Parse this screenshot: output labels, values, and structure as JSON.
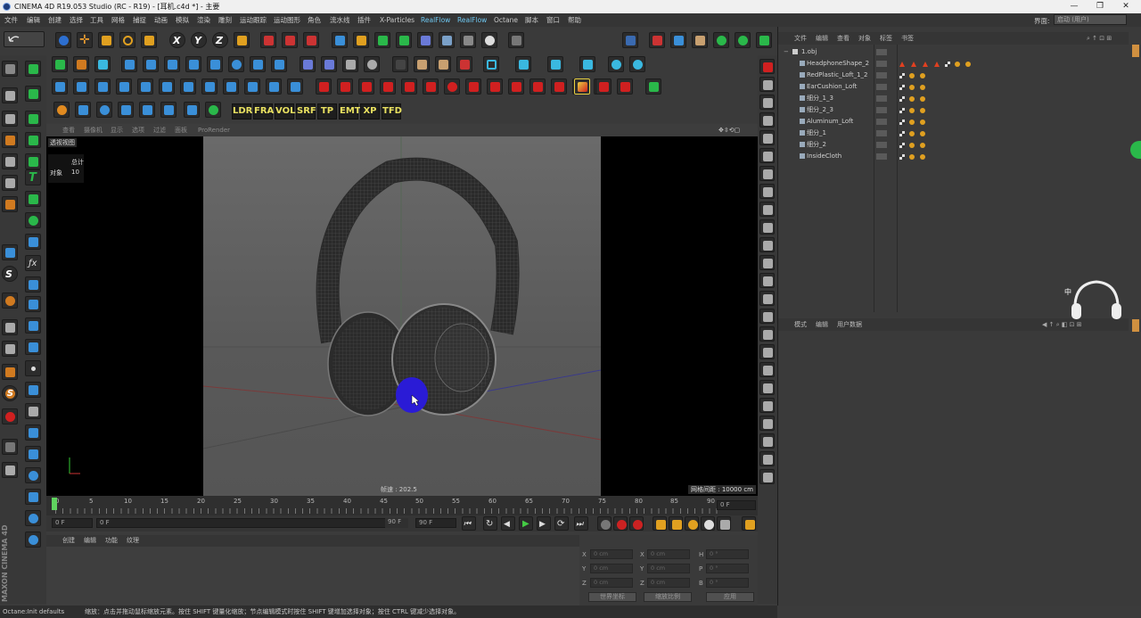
{
  "window": {
    "title": "CINEMA 4D R19.053 Studio (RC - R19) - [耳机.c4d *] - 主要",
    "controls": [
      "—",
      "❐",
      "✕"
    ]
  },
  "menubar": {
    "items": [
      "文件",
      "编辑",
      "创建",
      "选择",
      "工具",
      "网格",
      "捕捉",
      "动画",
      "模拟",
      "渲染",
      "雕刻",
      "运动跟踪",
      "运动图形",
      "角色",
      "流水线",
      "插件",
      "X-Particles",
      "RealFlow",
      "RealFlow",
      "Octane",
      "脚本",
      "窗口",
      "帮助"
    ],
    "interface_label": "界面:",
    "interface_value": "启动 (用户)"
  },
  "toolbar": {
    "render_labels": [
      "LDR",
      "FRA",
      "VOL",
      "SRF",
      "TP",
      "EMT",
      "XP",
      "TFD"
    ]
  },
  "viewport": {
    "menu": [
      "查看",
      "摄像机",
      "显示",
      "选项",
      "过滤",
      "面板",
      "ProRender"
    ],
    "view_label": "透视视图",
    "stats_total": "总计",
    "stats_objects_label": "对象",
    "stats_objects_value": "10",
    "speed": "帧速 : 202.5",
    "grid_spacing": "网格间距 : 10000 cm"
  },
  "timeline": {
    "ticks": [
      "0",
      "5",
      "10",
      "15",
      "20",
      "25",
      "30",
      "35",
      "40",
      "45",
      "50",
      "55",
      "60",
      "65",
      "70",
      "75",
      "80",
      "85",
      "90"
    ],
    "end_frame": "0 F",
    "start_field": "0 F",
    "current_field": "0 F",
    "range_end": "90 F",
    "max_field": "90 F"
  },
  "materials": {
    "menu": [
      "创建",
      "编辑",
      "功能",
      "纹理"
    ]
  },
  "coordinates": {
    "rows": [
      {
        "a": "X",
        "av": "0 cm",
        "b": "X",
        "bv": "0 cm",
        "c": "H",
        "cv": "0 °"
      },
      {
        "a": "Y",
        "av": "0 cm",
        "b": "Y",
        "bv": "0 cm",
        "c": "P",
        "cv": "0 °"
      },
      {
        "a": "Z",
        "av": "0 cm",
        "b": "Z",
        "bv": "0 cm",
        "c": "B",
        "cv": "0 °"
      }
    ],
    "mode_world": "世界坐标",
    "mode_scale": "缩放比例",
    "apply": "应用"
  },
  "status": {
    "left": "Octane:Init defaults",
    "message": "缩放：点击并拖动鼠标缩放元素。按住 SHIFT 键量化缩放；节点编辑模式时按住 SHIFT 键增加选择对象；按住 CTRL 键减少选择对象。"
  },
  "objects": {
    "menu": [
      "文件",
      "编辑",
      "查看",
      "对象",
      "标签",
      "书签"
    ],
    "root": "1.obj",
    "items": [
      "HeadphoneShape_2",
      "RedPlastic_Loft_1_2",
      "EarCushion_Loft",
      "细分_1_3",
      "细分_2_3",
      "Aluminum_Loft",
      "细分_1",
      "细分_2",
      "InsideCloth"
    ]
  },
  "attributes": {
    "menu": [
      "模式",
      "编辑",
      "用户数据"
    ]
  },
  "brand": "MAXON CINEMA 4D",
  "nav_cube_label": "中",
  "colors": {
    "accent_blue": "#3a7bd5",
    "selection_blue": "#2a1bd6",
    "realflow": "#6ec7f0",
    "render_label": "#e8e060"
  }
}
